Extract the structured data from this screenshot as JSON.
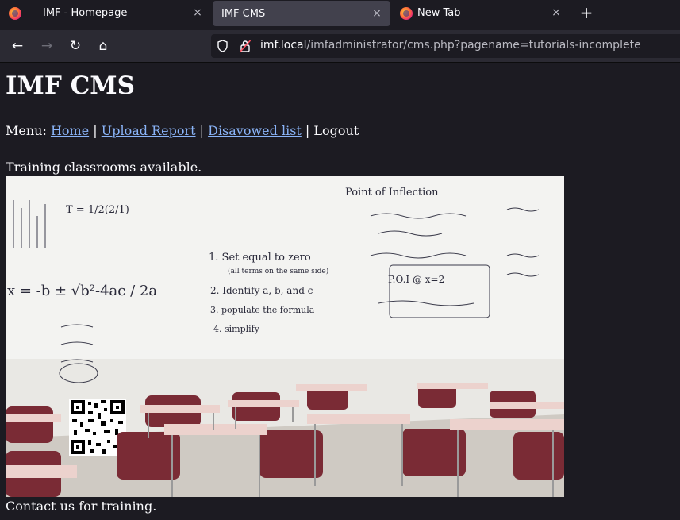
{
  "tabs": [
    {
      "label": "IMF - Homepage",
      "close": "×",
      "icon": "firefox-icon"
    },
    {
      "label": "IMF CMS",
      "close": "×",
      "active": true
    },
    {
      "label": "New Tab",
      "close": "×",
      "icon": "firefox-icon"
    }
  ],
  "new_tab": "+",
  "nav": {
    "back": "←",
    "forward": "→",
    "reload": "↻",
    "home": "⌂"
  },
  "url": {
    "host": "imf.local",
    "path": "/imfadministrator/cms.php?pagename=tutorials-incomplete"
  },
  "page": {
    "title": "IMF CMS",
    "menu_prefix": "Menu: ",
    "menu": [
      "Home",
      "Upload Report",
      "Disavowed list",
      "Logout"
    ],
    "menu_sep": " | ",
    "intro": "Training classrooms available.",
    "outro": "Contact us for training.",
    "image": {
      "description_icon": "classroom-photo",
      "board_text": [
        "Point of Inflection",
        "1. Set equal to zero",
        "(all terms on the same side)",
        "2. Identify a, b, and c",
        "3. populate the formula",
        "4. simplify",
        "P.O.I @ x=2",
        "x = -b ± √b²-4ac / 2a",
        "T = 1/2(2/1)"
      ]
    }
  }
}
